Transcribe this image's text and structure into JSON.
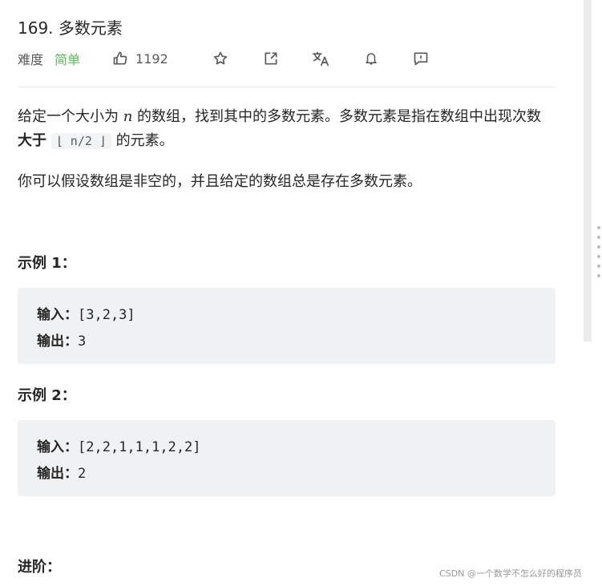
{
  "problem": {
    "title": "169. 多数元素",
    "difficulty_label": "难度",
    "difficulty": "简单",
    "likes": "1192"
  },
  "toolbar": {
    "icons": [
      "thumbs-up-icon",
      "star-icon",
      "share-icon",
      "translate-icon",
      "bell-icon",
      "feedback-icon"
    ]
  },
  "description": {
    "line1_part1": "给定一个大小为 ",
    "var_n": "n",
    "line1_part2": " 的数组，找到其中的多数元素。多数元素是指在数组中出现次数 ",
    "bold": "大于",
    "code": "⌊ n/2 ⌋",
    "line1_part3": " 的元素。",
    "line2": "你可以假设数组是非空的，并且给定的数组总是存在多数元素。"
  },
  "examples": [
    {
      "title": "示例 1：",
      "input_label": "输入：",
      "input": "[3,2,3]",
      "output_label": "输出：",
      "output": "3"
    },
    {
      "title": "示例 2：",
      "input_label": "输入：",
      "input": "[2,2,1,1,1,2,2]",
      "output_label": "输出：",
      "output": "2"
    }
  ],
  "advanced_title": "进阶：",
  "watermark": "CSDN @一个数学不怎么好的程序员",
  "colors": {
    "easy": "#5cb85c",
    "text": "#262626",
    "code_bg": "#f0f1f2"
  }
}
